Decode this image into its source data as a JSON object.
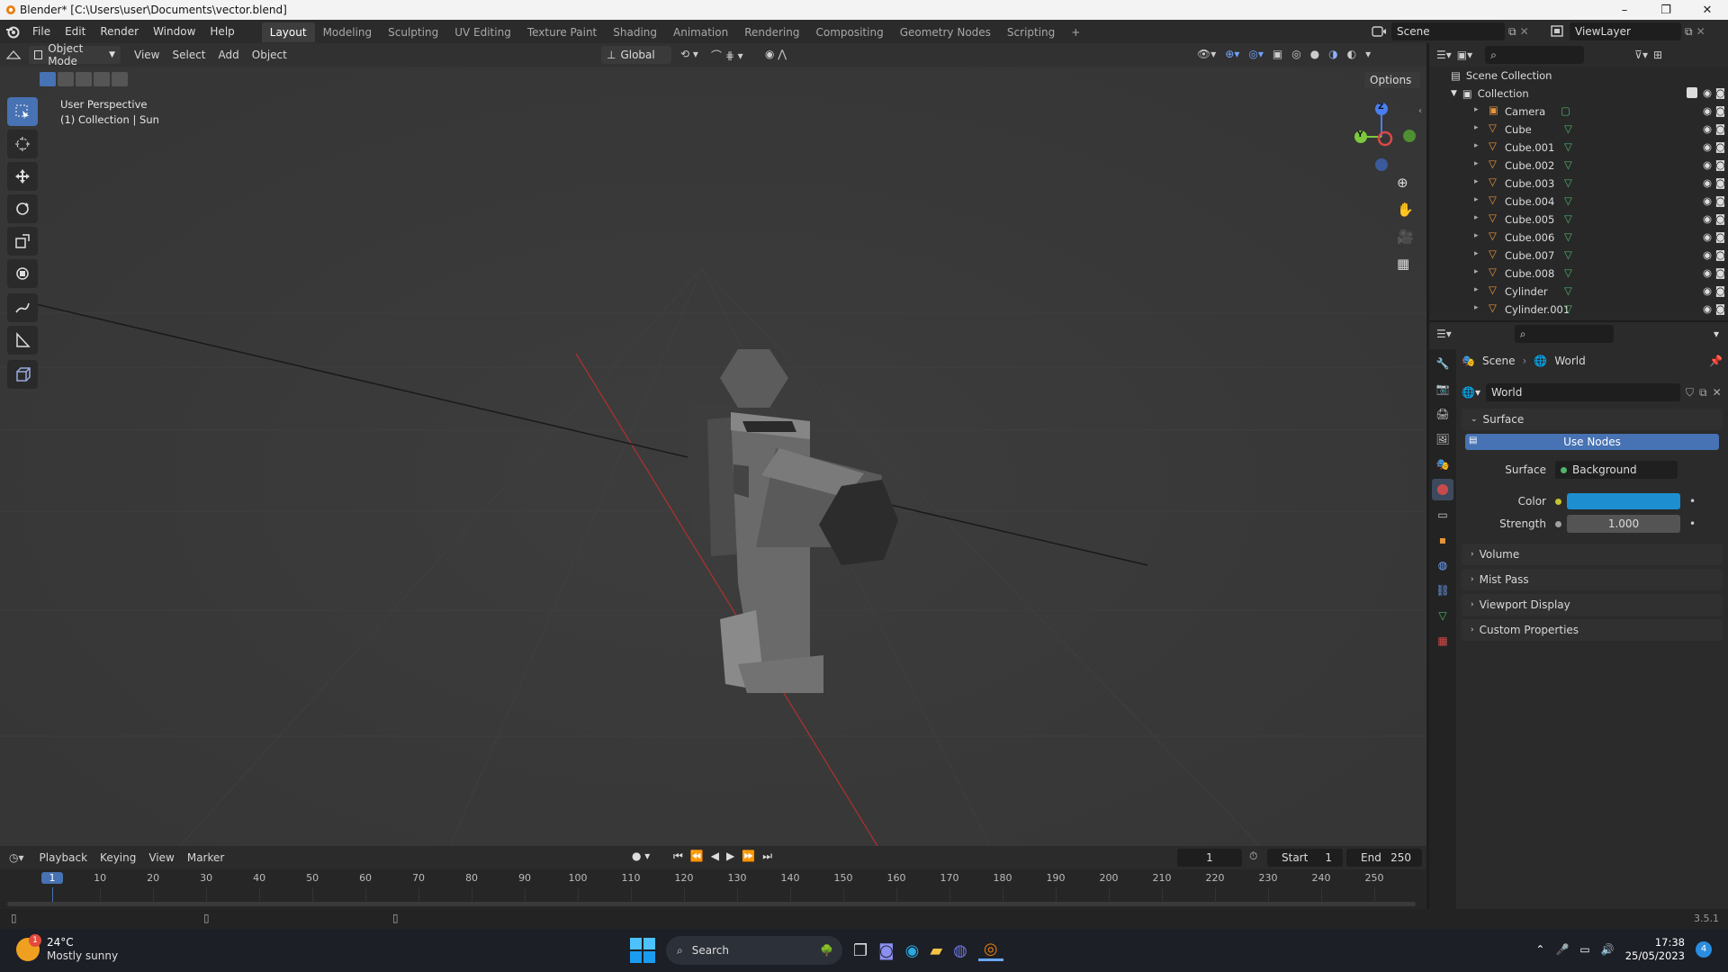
{
  "window": {
    "title": "Blender* [C:\\Users\\user\\Documents\\vector.blend]"
  },
  "menus": [
    "File",
    "Edit",
    "Render",
    "Window",
    "Help"
  ],
  "workspaces": [
    "Layout",
    "Modeling",
    "Sculpting",
    "UV Editing",
    "Texture Paint",
    "Shading",
    "Animation",
    "Rendering",
    "Compositing",
    "Geometry Nodes",
    "Scripting"
  ],
  "active_workspace": "Layout",
  "scene_name": "Scene",
  "view_layer": "ViewLayer",
  "viewport": {
    "mode": "Object Mode",
    "menu": [
      "View",
      "Select",
      "Add",
      "Object"
    ],
    "orientation": "Global",
    "options_label": "Options",
    "info_line1": "User Perspective",
    "info_line2": "(1) Collection | Sun",
    "gizmo": {
      "z": "Z",
      "y": "Y"
    }
  },
  "outliner": {
    "scene_collection": "Scene Collection",
    "collection": "Collection",
    "objects": [
      "Camera",
      "Cube",
      "Cube.001",
      "Cube.002",
      "Cube.003",
      "Cube.004",
      "Cube.005",
      "Cube.006",
      "Cube.007",
      "Cube.008",
      "Cylinder",
      "Cylinder.001"
    ]
  },
  "properties": {
    "breadcrumb_scene": "Scene",
    "breadcrumb_world": "World",
    "world_name": "World",
    "surface_panel": "Surface",
    "use_nodes": "Use Nodes",
    "surface_label": "Surface",
    "surface_value": "Background",
    "color_label": "Color",
    "color_value": "#1d8fd0",
    "strength_label": "Strength",
    "strength_value": "1.000",
    "panels": [
      "Volume",
      "Mist Pass",
      "Viewport Display",
      "Custom Properties"
    ]
  },
  "timeline": {
    "menus": [
      "Playback",
      "Keying",
      "View",
      "Marker"
    ],
    "current_frame": "1",
    "start_label": "Start",
    "start_value": "1",
    "end_label": "End",
    "end_value": "250",
    "ticks": [
      "1",
      "10",
      "20",
      "30",
      "40",
      "50",
      "60",
      "70",
      "80",
      "90",
      "100",
      "110",
      "120",
      "130",
      "140",
      "150",
      "160",
      "170",
      "180",
      "190",
      "200",
      "210",
      "220",
      "230",
      "240",
      "250"
    ]
  },
  "status": {
    "version": "3.5.1"
  },
  "taskbar": {
    "weather_temp": "24°C",
    "weather_desc": "Mostly sunny",
    "search": "Search",
    "time": "17:38",
    "date": "25/05/2023",
    "notifications": "4",
    "weather_badge": "1"
  }
}
